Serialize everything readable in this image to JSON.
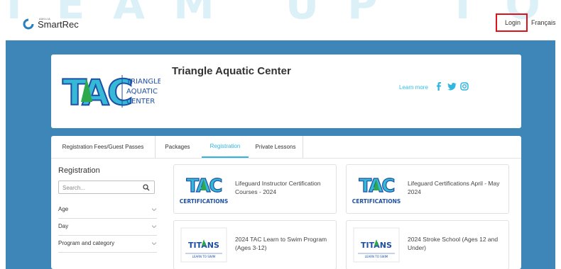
{
  "header": {
    "brand_top": "AMILIA",
    "brand": "SmartRec",
    "login": "Login",
    "language": "Français"
  },
  "watermark": "TEAM UP TO SWIM",
  "hero": {
    "title": "Triangle Aquatic Center",
    "learn_more": "Learn more",
    "logo_text": [
      "TRIANGLE",
      "AQUATIC",
      "CENTER"
    ],
    "logo_mark": "TAC"
  },
  "tabs": [
    {
      "label": "Registration Fees/Guest Passes",
      "active": false
    },
    {
      "label": "Packages",
      "active": false
    },
    {
      "label": "Registration",
      "active": true
    },
    {
      "label": "Private Lessons",
      "active": false
    }
  ],
  "sidebar": {
    "title": "Registration",
    "search_placeholder": "Search...",
    "filters": [
      "Age",
      "Day",
      "Program and category"
    ]
  },
  "cards": [
    {
      "title": "Lifeguard Instructor Certification Courses - 2024",
      "logo": "TAC",
      "logo_sub": "CERTIFICATIONS"
    },
    {
      "title": "Lifeguard Certifications April - May 2024",
      "logo": "TAC",
      "logo_sub": "CERTIFICATIONS"
    },
    {
      "title": "2024 TAC Learn to Swim Program (Ages 3-12)",
      "logo": "TITANS",
      "logo_sub": "LEARN TO SWIM"
    },
    {
      "title": "2024 Stroke School (Ages 12 and Under)",
      "logo": "TITANS",
      "logo_sub": "LEARN TO SWIM"
    }
  ],
  "colors": {
    "main_bg": "#3f86b8",
    "accent": "#30b6e0",
    "login_highlight": "#e0101c",
    "tac_blue": "#1e4fa6",
    "tac_teal": "#36b9d6"
  }
}
